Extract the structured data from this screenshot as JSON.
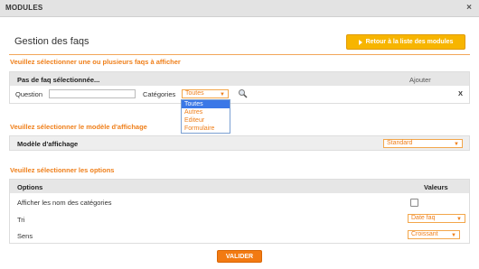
{
  "window": {
    "title": "MODULES",
    "close_label": "×"
  },
  "page_title": "Gestion des faqs",
  "back_button": {
    "label": "Retour à la liste des modules"
  },
  "section1": {
    "title": "Veuillez sélectionner une ou plusieurs faqs à afficher",
    "header_left": "Pas de faq sélectionnée...",
    "header_right": "Ajouter",
    "question_label": "Question",
    "question_value": "",
    "categories_label": "Catégories",
    "categories_selected": "Toutes",
    "remove_label": "X",
    "dropdown_options": [
      "Toutes",
      "Autres",
      "Editeur",
      "Formulaire"
    ]
  },
  "section2": {
    "title": "Veuillez sélectionner le modèle d'affichage",
    "row_label": "Modèle d'affichage",
    "selected": "Standard"
  },
  "section3": {
    "title": "Veuillez sélectionner les options",
    "col_options": "Options",
    "col_values": "Valeurs",
    "rows": [
      {
        "label": "Afficher les nom des catégories",
        "type": "checkbox",
        "checked": false
      },
      {
        "label": "Tri",
        "type": "select",
        "value": "Date faq"
      },
      {
        "label": "Sens",
        "type": "select",
        "value": "Croissant"
      }
    ]
  },
  "submit": {
    "label": "VALIDER"
  },
  "colors": {
    "accent": "#ef7f1a",
    "button_yellow": "#f7b500",
    "button_orange": "#f27a12",
    "dropdown_highlight": "#3b78e7"
  },
  "icons": {
    "search": "magnifier-icon",
    "back": "play-arrow-icon",
    "close": "close-icon"
  }
}
